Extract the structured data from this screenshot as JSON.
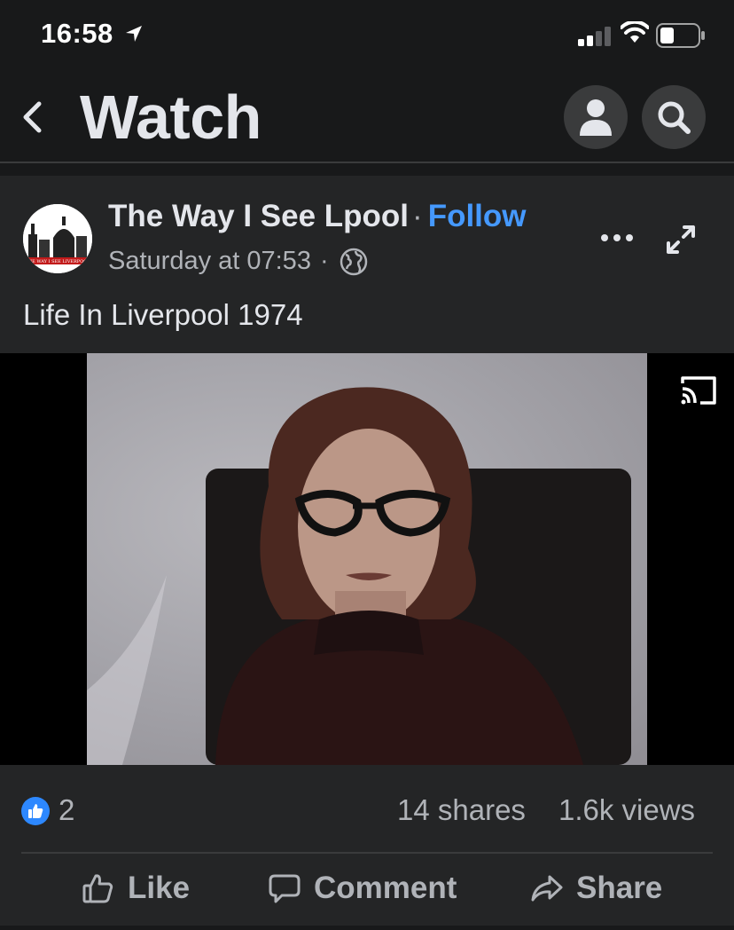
{
  "status_bar": {
    "time": "16:58"
  },
  "header": {
    "title": "Watch"
  },
  "post": {
    "author": "The Way I See Lpool",
    "separator": "·",
    "follow_label": "Follow",
    "timestamp": "Saturday at 07:53",
    "timestamp_separator": "·",
    "caption": "Life In Liverpool 1974",
    "avatar_text": "THE WAY I SEE LIVERPOOL",
    "reactions": {
      "icon": "thumbs-up-icon",
      "count": "2"
    },
    "shares": "14 shares",
    "views": "1.6k views"
  },
  "actions": {
    "like": "Like",
    "comment": "Comment",
    "share": "Share"
  },
  "colors": {
    "background": "#18191a",
    "card": "#242526",
    "accent": "#4599ff",
    "like_badge": "#2d88ff",
    "secondary_text": "#b0b3b8"
  }
}
